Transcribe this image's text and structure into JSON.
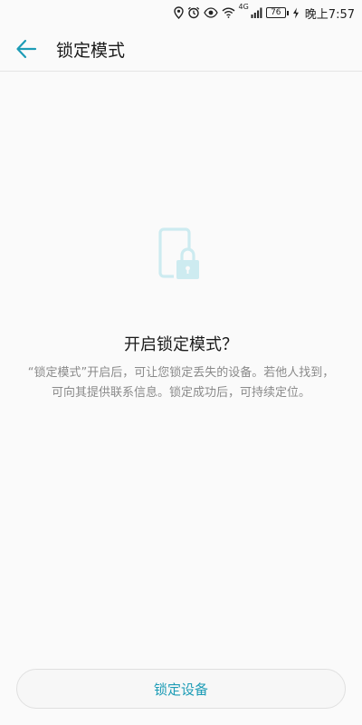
{
  "status_bar": {
    "network_label": "4G",
    "battery_level": "76",
    "time": "晚上7:57",
    "icons": [
      "location-icon",
      "alarm-icon",
      "eye-icon",
      "wifi-icon",
      "signal-icon",
      "battery-icon",
      "charging-icon"
    ]
  },
  "app_bar": {
    "back_icon": "back-arrow-icon",
    "title": "锁定模式"
  },
  "main": {
    "illustration_icon": "phone-lock-icon",
    "heading": "开启锁定模式？",
    "description": "“锁定模式”开启后，可让您锁定丢失的设备。若他人找到，可向其提供联系信息。锁定成功后，可持续定位。"
  },
  "footer": {
    "lock_button_label": "锁定设备"
  },
  "colors": {
    "accent": "#1d9cb6",
    "illustration": "#cdebf0",
    "background": "#fafafa",
    "secondary_text": "#8a8a8a"
  }
}
